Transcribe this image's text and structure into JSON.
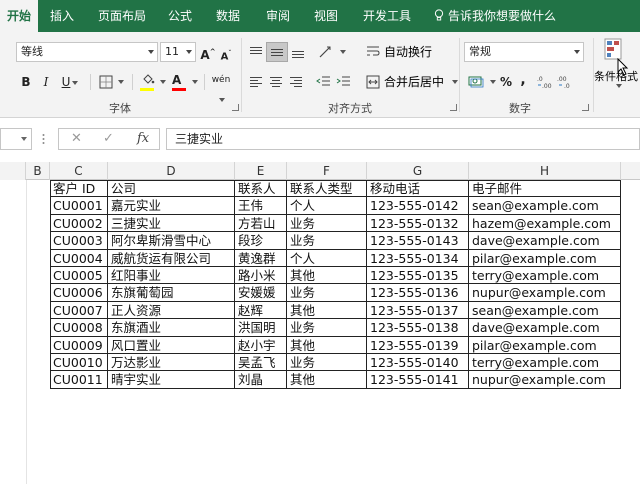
{
  "tabs": [
    "开始",
    "插入",
    "页面布局",
    "公式",
    "数据",
    "审阅",
    "视图",
    "开发工具"
  ],
  "tell_me": "告诉我你想要做什么",
  "ribbon": {
    "font_name": "等线",
    "font_size": "11",
    "bold": "B",
    "italic": "I",
    "underline": "U",
    "font_color_glyph": "A",
    "grow_font": "A",
    "shrink_font": "A",
    "phonetic": "wén",
    "wrap_text": "自动换行",
    "merge_center": "合并后居中",
    "number_format": "常规",
    "percent": "%",
    "comma": ",",
    "conditional_format": "条件格式",
    "groups": {
      "font": "字体",
      "alignment": "对齐方式",
      "number": "数字"
    },
    "colors": {
      "highlight": "#ffff00",
      "font_color": "#ff0000",
      "accent": "#217346"
    }
  },
  "formula_bar": {
    "cancel": "✕",
    "enter": "✓",
    "fx": "fx",
    "value": "三捷实业"
  },
  "columns": [
    "B",
    "C",
    "D",
    "E",
    "F",
    "G",
    "H"
  ],
  "table": {
    "headers": [
      "客户 ID",
      "公司",
      "联系人",
      "联系人类型",
      "移动电话",
      "电子邮件"
    ],
    "rows": [
      [
        "CU0001",
        "嘉元实业",
        "王伟",
        "个人",
        "123-555-0142",
        "sean@example.com"
      ],
      [
        "CU0002",
        "三捷实业",
        "方若山",
        "业务",
        "123-555-0132",
        "hazem@example.com"
      ],
      [
        "CU0003",
        "阿尔卑斯滑雪中心",
        "段珍",
        "业务",
        "123-555-0143",
        "dave@example.com"
      ],
      [
        "CU0004",
        "威航货运有限公司",
        "黄逸群",
        "个人",
        "123-555-0134",
        "pilar@example.com"
      ],
      [
        "CU0005",
        "红阳事业",
        "路小米",
        "其他",
        "123-555-0135",
        "terry@example.com"
      ],
      [
        "CU0006",
        "东旗葡萄园",
        "安媛媛",
        "业务",
        "123-555-0136",
        "nupur@example.com"
      ],
      [
        "CU0007",
        "正人资源",
        "赵辉",
        "其他",
        "123-555-0137",
        "sean@example.com"
      ],
      [
        "CU0008",
        "东旗酒业",
        "洪国明",
        "业务",
        "123-555-0138",
        "dave@example.com"
      ],
      [
        "CU0009",
        "风口置业",
        "赵小宇",
        "其他",
        "123-555-0139",
        "pilar@example.com"
      ],
      [
        "CU0010",
        "万达影业",
        "吴孟飞",
        "业务",
        "123-555-0140",
        "terry@example.com"
      ],
      [
        "CU0011",
        "晴宇实业",
        "刘晶",
        "其他",
        "123-555-0141",
        "nupur@example.com"
      ]
    ]
  }
}
